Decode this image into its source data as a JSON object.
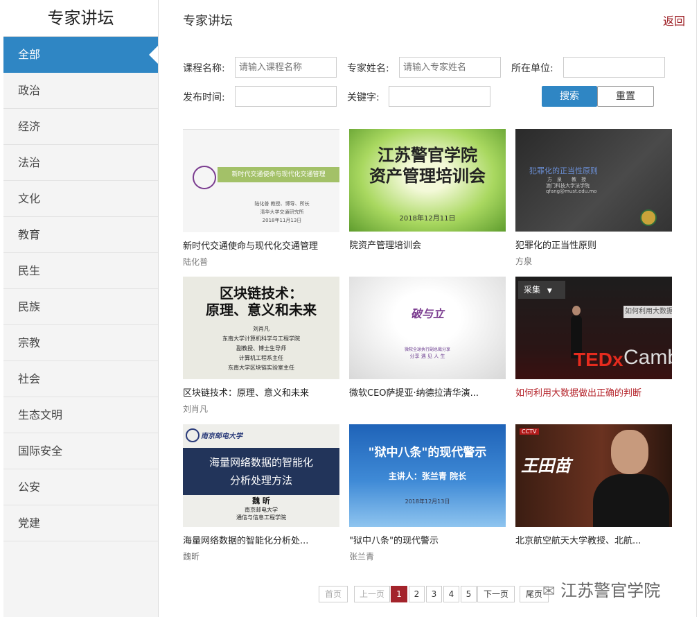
{
  "sidebar": {
    "title": "专家讲坛",
    "items": [
      "全部",
      "政治",
      "经济",
      "法治",
      "文化",
      "教育",
      "民生",
      "民族",
      "宗教",
      "社会",
      "生态文明",
      "国际安全",
      "公安",
      "党建"
    ]
  },
  "header": {
    "title": "专家讲坛",
    "back": "返回"
  },
  "search": {
    "course_label": "课程名称:",
    "course_placeholder": "请输入课程名称",
    "expert_label": "专家姓名:",
    "expert_placeholder": "请输入专家姓名",
    "unit_label": "所在单位:",
    "time_label": "发布时间:",
    "keyword_label": "关键字:",
    "search_btn": "搜索",
    "reset_btn": "重置"
  },
  "cards": [
    {
      "title": "新时代交通使命与现代化交通管理",
      "author": "陆化普",
      "thumb": {
        "banner": "新时代交通使命与现代化交通管理",
        "l1": "陆化普 教授、博导、所长",
        "l2": "清华大学交通研究所",
        "l3": "2018年11月13日"
      }
    },
    {
      "title": "院资产管理培训会",
      "author": "",
      "thumb": {
        "t1": "江苏警官学院",
        "t2": "资产管理培训会",
        "date": "2018年12月11日"
      }
    },
    {
      "title": "犯罪化的正当性原则",
      "author": "方泉",
      "thumb": {
        "t1": "犯罪化的正当性原则",
        "l1": "方　泉　　教　授",
        "l2": "澳门科技大学法学院",
        "l3": "qfang@must.edu.mo"
      }
    },
    {
      "title": "区块链技术：原理、意义和未来",
      "author": "刘肖凡",
      "thumb": {
        "t1": "区块链技术：",
        "t2": "原理、意义和未来",
        "l1": "刘肖凡",
        "l2": "东南大学计算机科学与工程学院",
        "l3": "副教授、博士生导师",
        "l4": "计算机工程系主任",
        "l5": "东南大学区块链实验室主任"
      }
    },
    {
      "title": "微软CEO萨提亚·纳德拉清华演...",
      "author": "",
      "thumb": {
        "t1": "破与立",
        "l1": "微软全球执行副总裁分享",
        "l2": "分享 遇 见 人 生"
      }
    },
    {
      "title": "如何利用大数据做出正确的判断",
      "author": "",
      "thumb": {
        "collect": "采集",
        "overlay": "如何利用大数据做出",
        "tedx": "TEDx",
        "camb": "Camb"
      }
    },
    {
      "title": "海量网络数据的智能化分析处...",
      "author": "魏昕",
      "thumb": {
        "school": "南京邮电大学",
        "t1": "海量网络数据的智能化",
        "t2": "分析处理方法",
        "name": "魏 昕",
        "l1": "南京邮电大学",
        "l2": "通信与信息工程学院"
      }
    },
    {
      "title": "\"狱中八条\"的现代警示",
      "author": "张兰青",
      "thumb": {
        "t1": "\"狱中八条\"的现代警示",
        "t2": "主讲人：张兰青 院长",
        "date": "2018年12月13日"
      }
    },
    {
      "title": "北京航空航天大学教授、北航...",
      "author": "",
      "thumb": {
        "name": "王田苗",
        "logo": "CCTV"
      }
    }
  ],
  "pagination": {
    "first": "首页",
    "prev": "上一页",
    "pages": [
      "1",
      "2",
      "3",
      "4",
      "5"
    ],
    "current": "1",
    "next": "下一页",
    "last": "尾页"
  },
  "watermark": "江苏警官学院",
  "colors": {
    "accent": "#2f86c4",
    "highlight": "#b5252c",
    "pager_current": "#a3232b"
  }
}
